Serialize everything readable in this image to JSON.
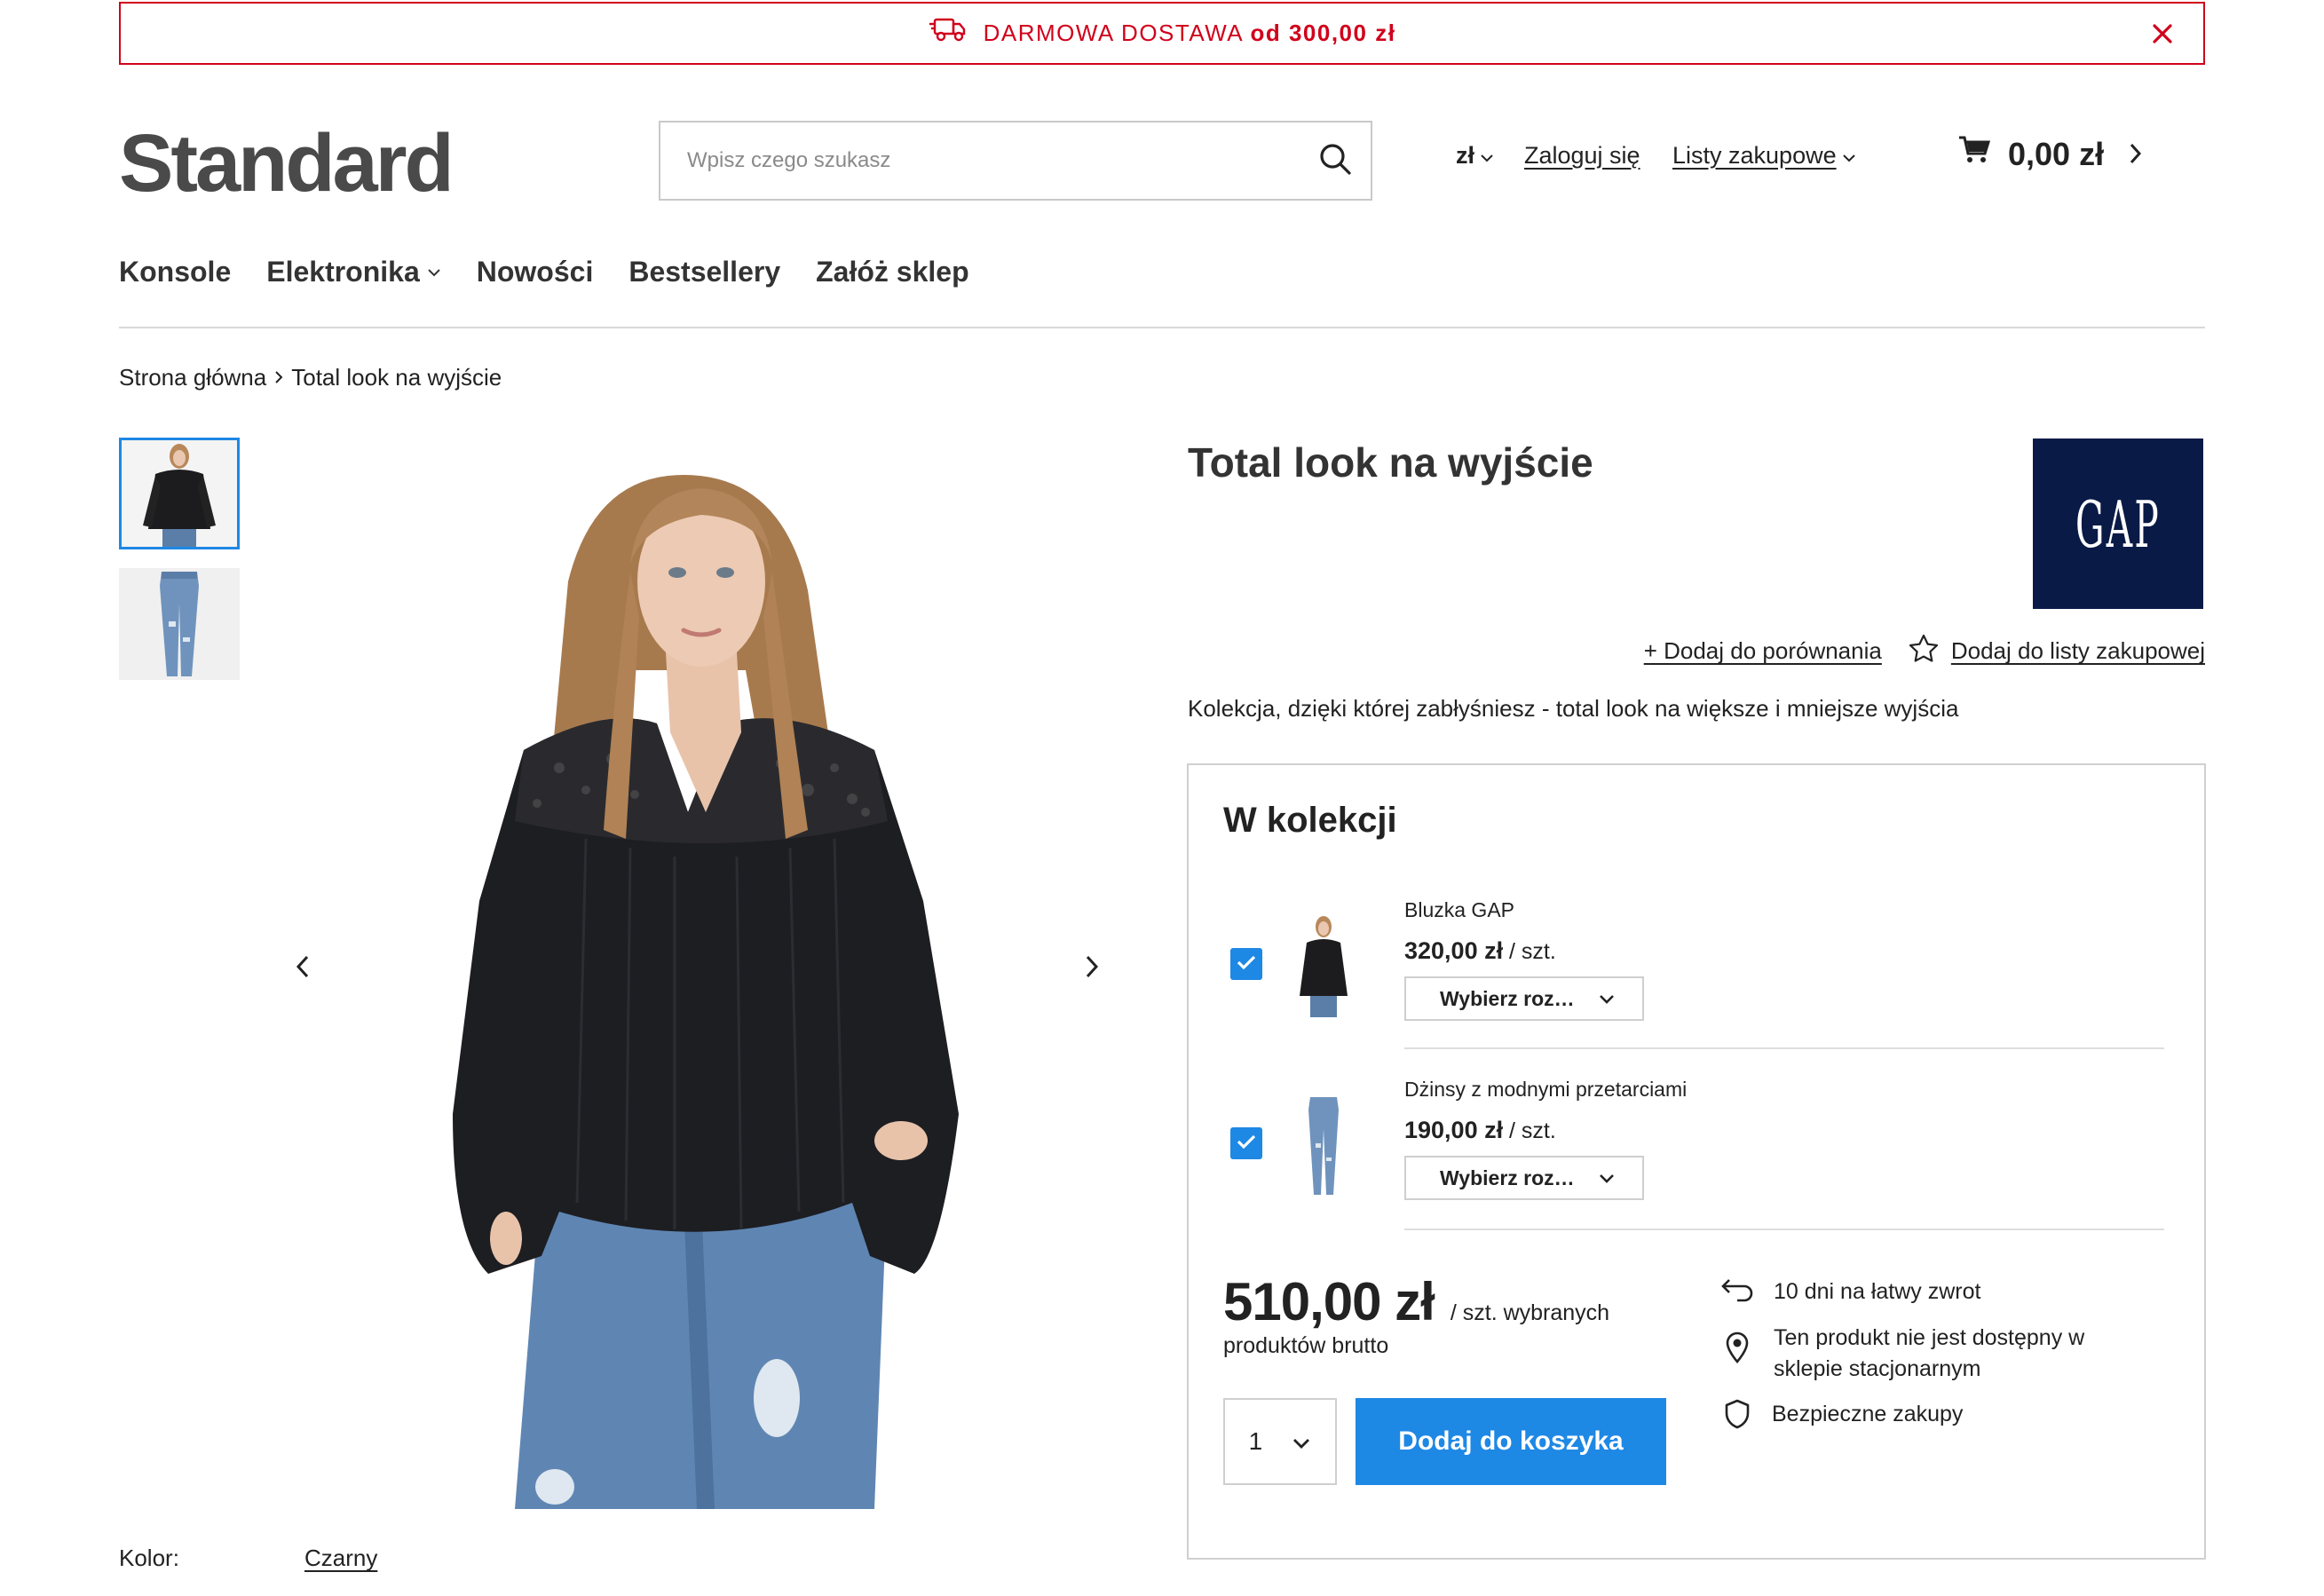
{
  "promo": {
    "text": "DARMOWA DOSTAWA",
    "bold": "od 300,00 zł",
    "color": "#d0021b"
  },
  "header": {
    "logo": "Standard",
    "search_placeholder": "Wpisz czego szukasz",
    "currency": "zł",
    "login": "Zaloguj się",
    "lists": "Listy zakupowe",
    "cart_total": "0,00 zł"
  },
  "nav": {
    "items": [
      "Konsole",
      "Elektronika",
      "Nowości",
      "Bestsellery",
      "Załóż sklep"
    ]
  },
  "breadcrumb": {
    "home": "Strona główna",
    "current": "Total look na wyjście"
  },
  "gallery": {
    "color_label": "Kolor:",
    "color_value": "Czarny"
  },
  "product": {
    "title": "Total look na wyjście",
    "brand_logo": "GAP",
    "compare": "+ Dodaj do porównania",
    "add_to_list": "Dodaj do listy zakupowej",
    "description": "Kolekcja, dzięki której zabłyśniesz - total look na większe i mniejsze wyjścia"
  },
  "collection": {
    "title": "W kolekcji",
    "items": [
      {
        "name": "Bluzka GAP",
        "price": "320,00 zł",
        "unit": " / szt.",
        "size_placeholder": "Wybierz roz…",
        "checked": true
      },
      {
        "name": "Dżinsy z modnymi przetarciami",
        "price": "190,00 zł",
        "unit": " / szt.",
        "size_placeholder": "Wybierz roz…",
        "checked": true
      }
    ],
    "total": "510,00 zł",
    "total_per": "/ szt. wybranych",
    "total_note": "produktów brutto",
    "quantity": "1",
    "add_button": "Dodaj do koszyka",
    "perks": {
      "return": "10 dni na łatwy zwrot",
      "store_line1": "Ten produkt nie jest dostępny w",
      "store_line2": "sklepie stacjonarnym",
      "secure": "Bezpieczne zakupy"
    }
  },
  "colors": {
    "accent": "#1e88e5",
    "promo_red": "#d0021b",
    "brand_navy": "#0a1a46"
  }
}
